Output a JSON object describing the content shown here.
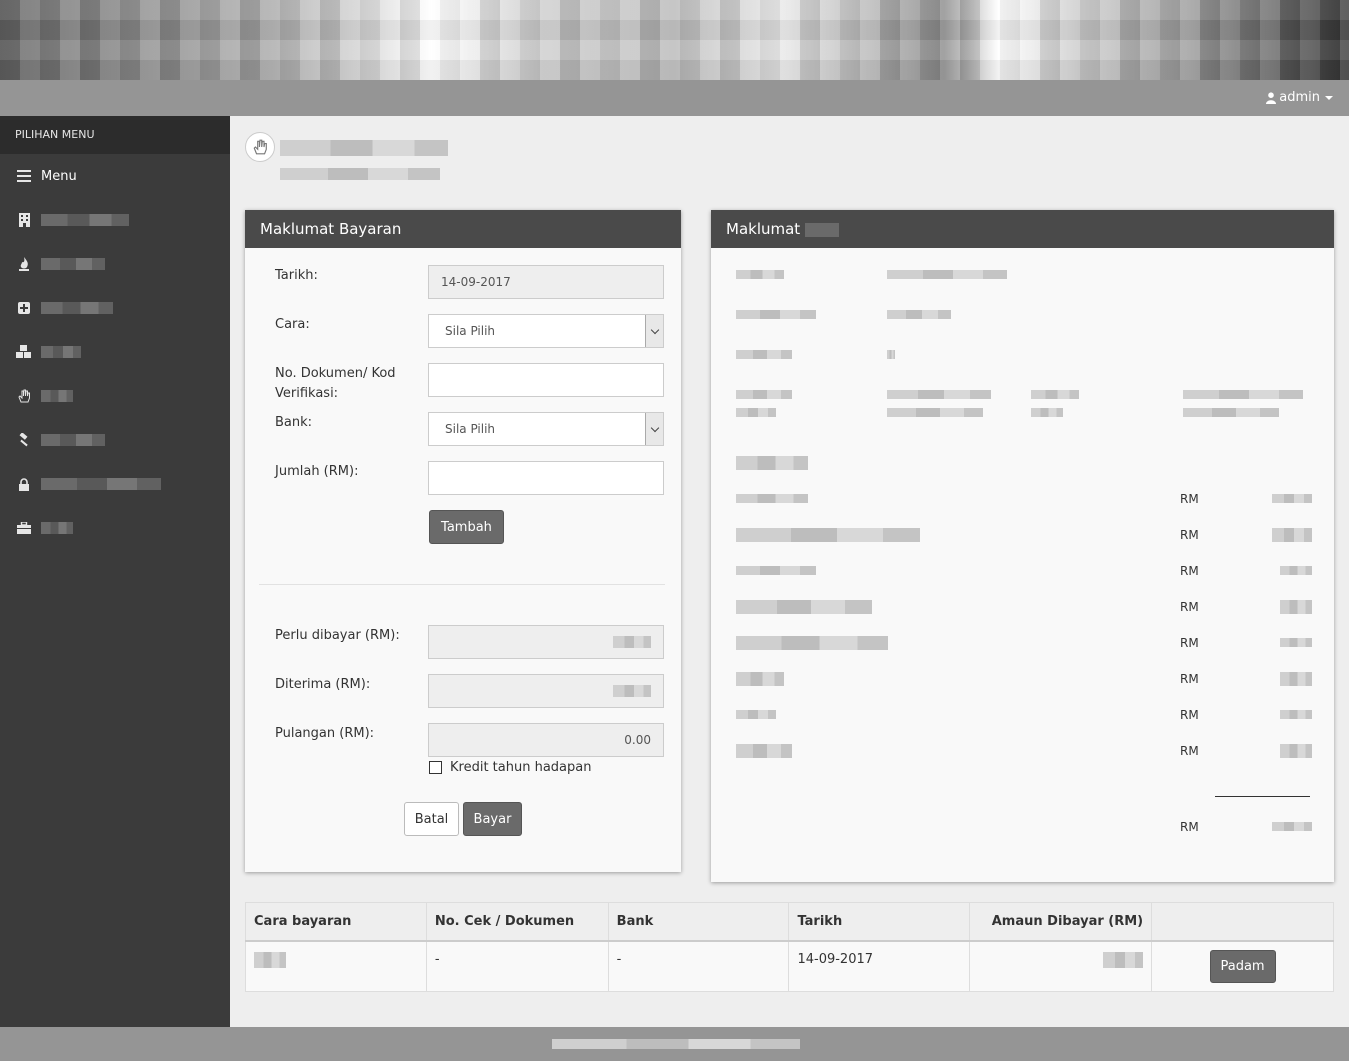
{
  "user": {
    "name": "admin"
  },
  "sidebar": {
    "header": "PILIHAN MENU",
    "menu_label": "Menu",
    "items": [
      {
        "icon": "building-icon"
      },
      {
        "icon": "fire-icon"
      },
      {
        "icon": "plus-square-icon"
      },
      {
        "icon": "cubes-icon"
      },
      {
        "icon": "hand-icon"
      },
      {
        "icon": "gavel-icon"
      },
      {
        "icon": "lock-icon"
      },
      {
        "icon": "briefcase-icon"
      }
    ]
  },
  "payment_panel": {
    "title": "Maklumat Bayaran",
    "date_label": "Tarikh:",
    "date_value": "14-09-2017",
    "method_label": "Cara:",
    "method_value": "Sila Pilih",
    "doc_label_1": "No. Dokumen/ Kod",
    "doc_label_2": "Verifikasi:",
    "bank_label": "Bank:",
    "bank_value": "Sila Pilih",
    "amount_label": "Jumlah (RM):",
    "add_button": "Tambah",
    "due_label": "Perlu dibayar (RM):",
    "received_label": "Diterima (RM):",
    "change_label": "Pulangan (RM):",
    "change_value": "0.00",
    "credit_label": "Kredit tahun hadapan",
    "cancel_button": "Batal",
    "pay_button": "Bayar"
  },
  "info_panel": {
    "title": "Maklumat",
    "currency_labels": [
      "RM",
      "RM",
      "RM",
      "RM",
      "RM",
      "RM",
      "RM",
      "RM"
    ],
    "total_currency": "RM"
  },
  "table": {
    "headers": [
      "Cara bayaran",
      "No. Cek / Dokumen",
      "Bank",
      "Tarikh",
      "Amaun Dibayar (RM)",
      ""
    ],
    "row": {
      "doc": "-",
      "bank": "-",
      "date": "14-09-2017",
      "delete_button": "Padam"
    }
  }
}
